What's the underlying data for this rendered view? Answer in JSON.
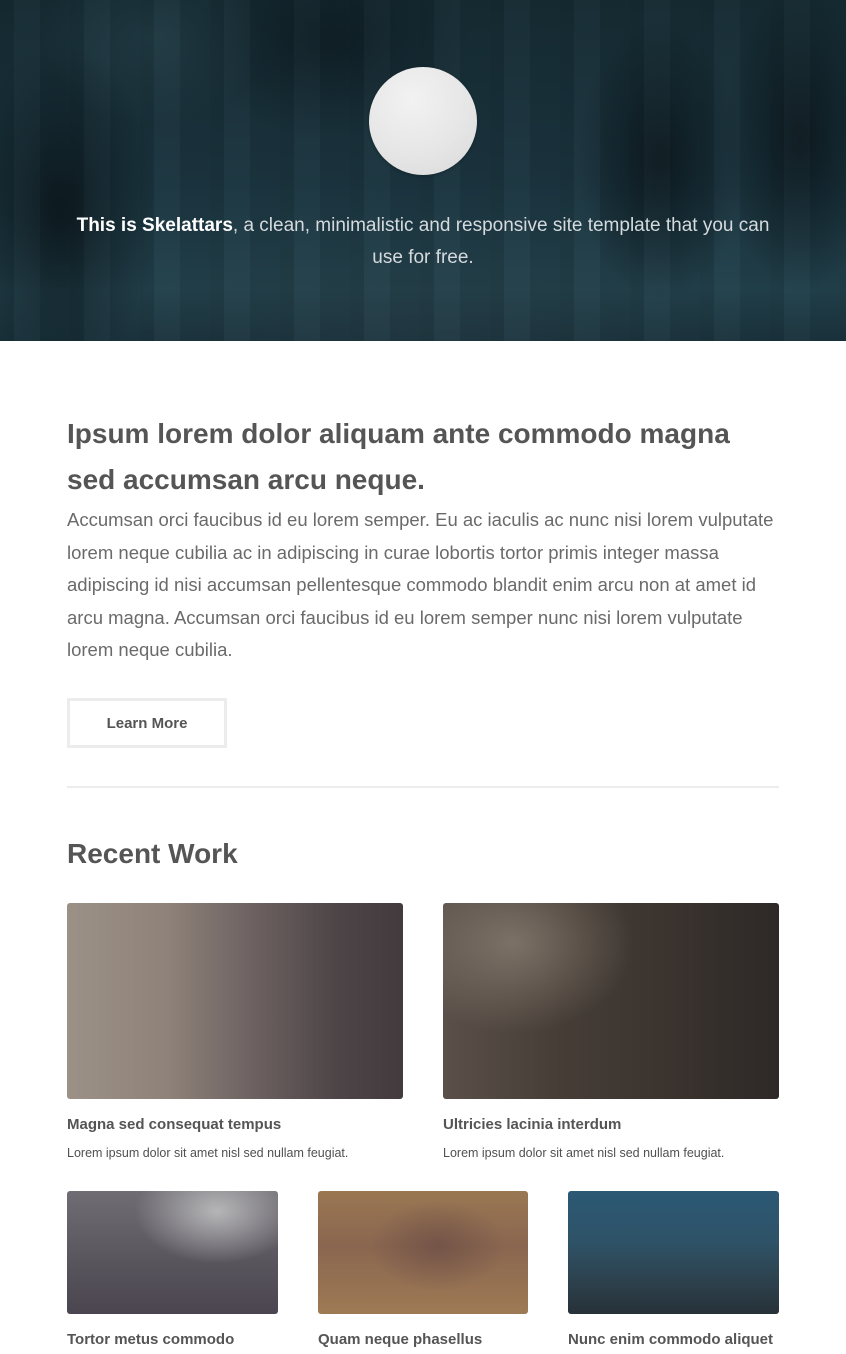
{
  "hero": {
    "title_strong": "This is Skelattars",
    "title_rest": ", a clean, minimalistic and responsive site template that you can use for free."
  },
  "intro": {
    "headline": "Ipsum lorem dolor aliquam ante commodo magna sed accumsan arcu neque.",
    "body": "Accumsan orci faucibus id eu lorem semper. Eu ac iaculis ac nunc nisi lorem vulputate lorem neque cubilia ac in adipiscing in curae lobortis tortor primis integer massa adipiscing id nisi accumsan pellentesque commodo blandit enim arcu non at amet id arcu magna. Accumsan orci faucibus id eu lorem semper nunc nisi lorem vulputate lorem neque cubilia.",
    "button_label": "Learn More"
  },
  "recent_work": {
    "title": "Recent Work",
    "items": [
      {
        "title": "Magna sed consequat tempus",
        "desc": "Lorem ipsum dolor sit amet nisl sed nullam feugiat."
      },
      {
        "title": "Ultricies lacinia interdum",
        "desc": "Lorem ipsum dolor sit amet nisl sed nullam feugiat."
      },
      {
        "title": "Tortor metus commodo",
        "desc": ""
      },
      {
        "title": "Quam neque phasellus",
        "desc": ""
      },
      {
        "title": "Nunc enim commodo aliquet",
        "desc": ""
      }
    ]
  }
}
